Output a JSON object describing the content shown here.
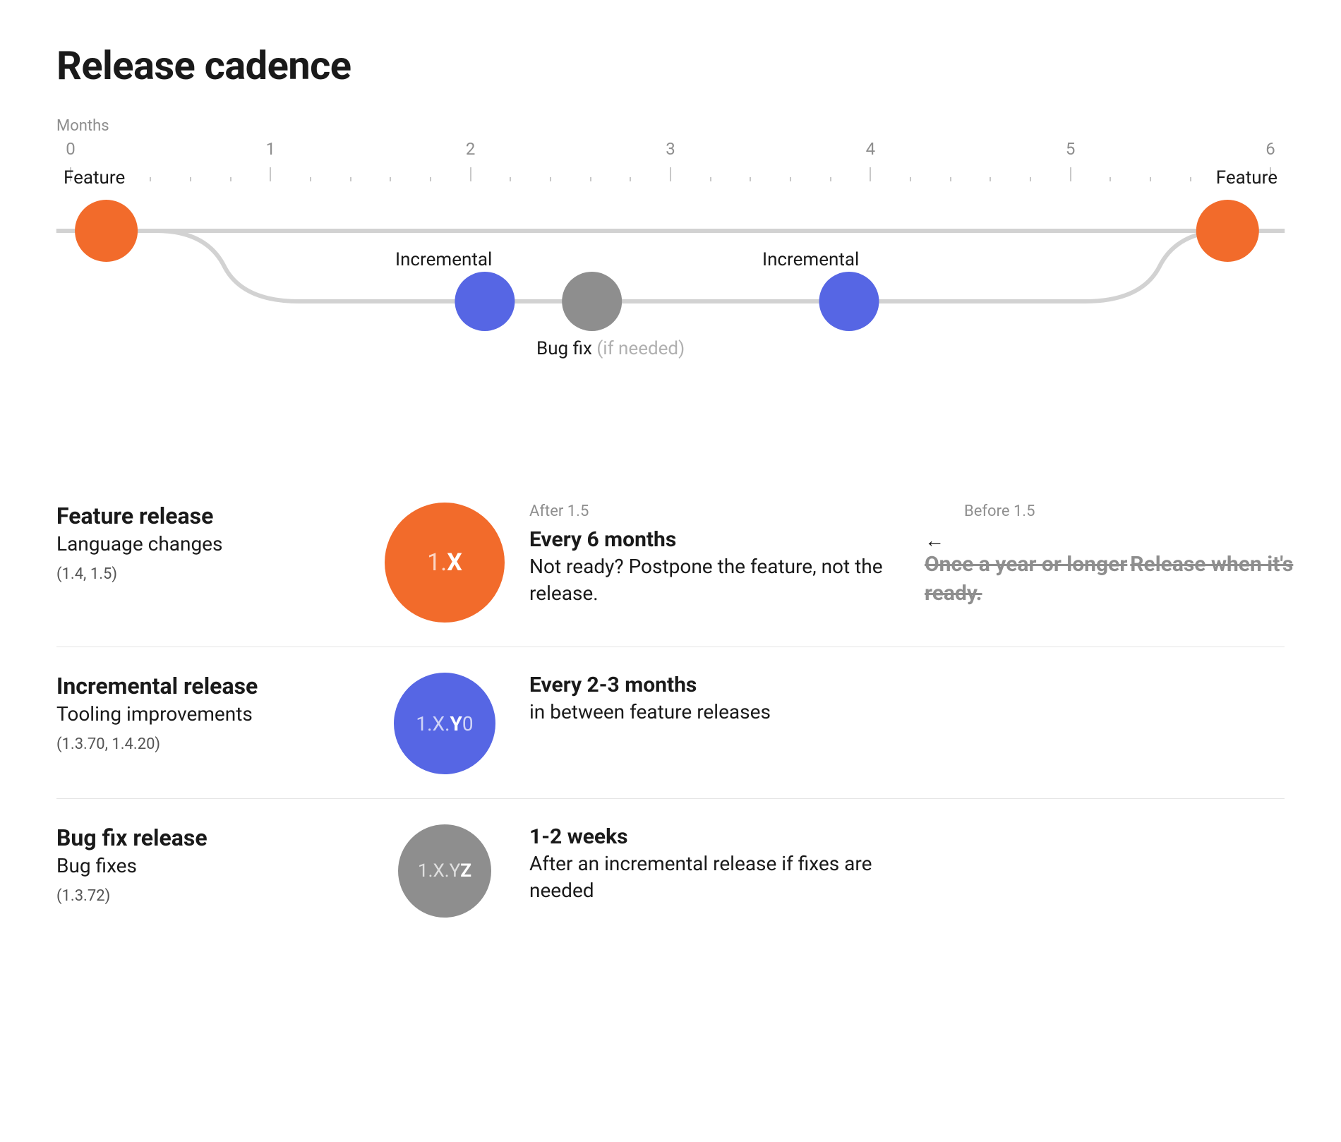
{
  "title": "Release cadence",
  "timeline": {
    "axis_label": "Months",
    "ticks": [
      "0",
      "1",
      "2",
      "3",
      "4",
      "5",
      "6"
    ],
    "nodes": {
      "feature_start": "Feature",
      "feature_end": "Feature",
      "incremental1": "Incremental",
      "incremental2": "Incremental",
      "bugfix_label": "Bug fix",
      "bugfix_hint": "(if needed)"
    },
    "colors": {
      "feature": "#F26B2B",
      "incremental": "#5666E4",
      "bugfix": "#8e8e8e",
      "track": "#d2d2d2"
    }
  },
  "rows": [
    {
      "title": "Feature release",
      "subtitle": "Language changes",
      "examples": "(1.4, 1.5)",
      "badge_prefix": "1.",
      "badge_strong": "X",
      "after_header": "After 1.5",
      "after_bold": "Every 6 months",
      "after_body": "Not ready? Postpone the feature, not the release.",
      "before_header": "Before 1.5",
      "before_bold": "Once a year or longer",
      "before_body": "Release when it's ready."
    },
    {
      "title": "Incremental release",
      "subtitle": "Tooling improvements",
      "examples": "(1.3.70, 1.4.20)",
      "badge_prefix": "1.X.",
      "badge_strong": "Y",
      "badge_suffix": "0",
      "after_bold": "Every 2-3 months",
      "after_body": "in between feature releases"
    },
    {
      "title": "Bug fix release",
      "subtitle": "Bug fixes",
      "examples": "(1.3.72)",
      "badge_prefix": "1.X.Y",
      "badge_strong": "Z",
      "after_bold": "1-2 weeks",
      "after_body": "After an incremental release if fixes are needed"
    }
  ]
}
